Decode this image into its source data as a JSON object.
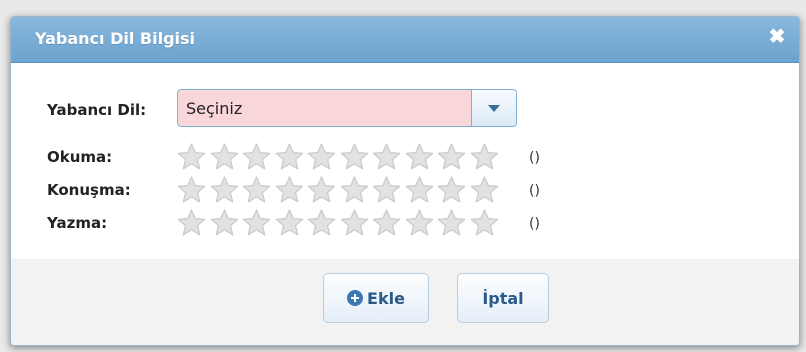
{
  "dialog": {
    "title": "Yabancı Dil Bilgisi",
    "close_icon": "close-icon"
  },
  "form": {
    "language_label": "Yabancı Dil:",
    "language_value": "Seçiniz",
    "rows": [
      {
        "label": "Okuma:",
        "stars_total": 10,
        "stars_selected": 0,
        "value_text": "()"
      },
      {
        "label": "Konuşma:",
        "stars_total": 10,
        "stars_selected": 0,
        "value_text": "()"
      },
      {
        "label": "Yazma:",
        "stars_total": 10,
        "stars_selected": 0,
        "value_text": "()"
      }
    ]
  },
  "buttons": {
    "add_label": "Ekle",
    "cancel_label": "İptal"
  },
  "colors": {
    "titlebar": "#6da3cf",
    "select_invalid": "#f9d6d9",
    "star_empty": "#e2e2e2"
  }
}
